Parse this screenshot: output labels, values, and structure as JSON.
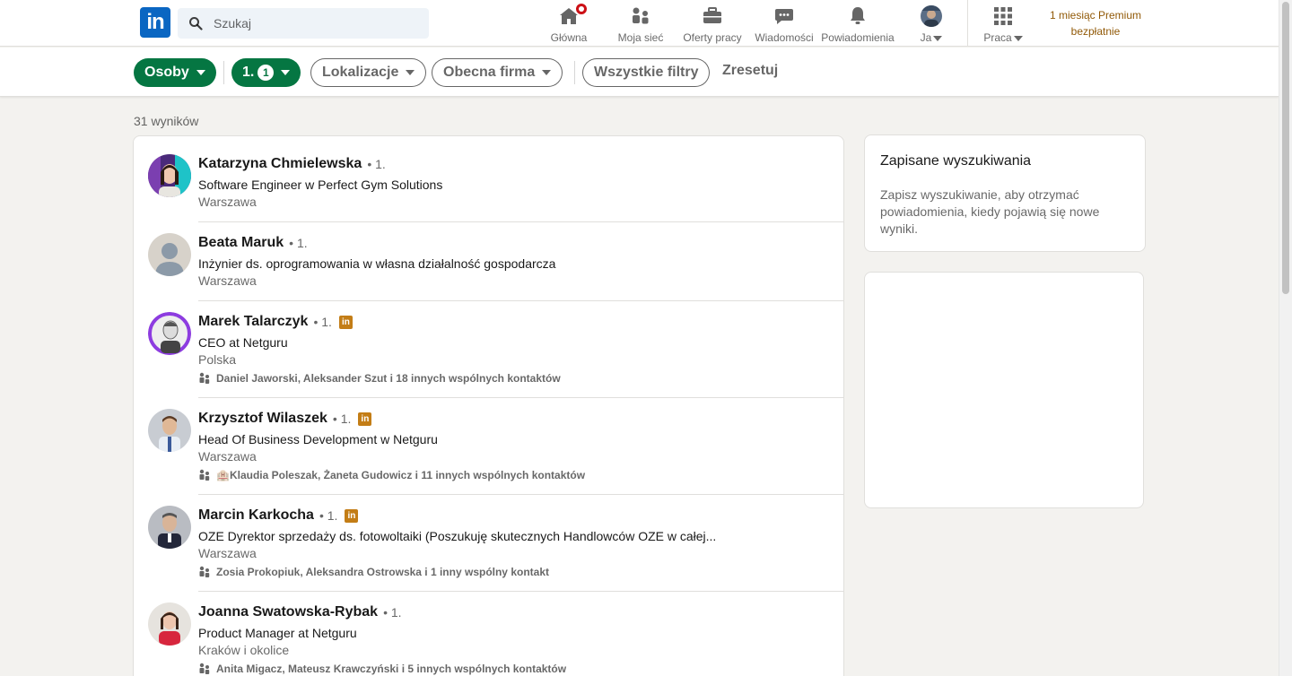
{
  "nav": {
    "logo": "in",
    "search_placeholder": "Szukaj",
    "items": [
      {
        "label": "Główna",
        "icon": "home-icon",
        "badge": true
      },
      {
        "label": "Moja sieć",
        "icon": "network-icon"
      },
      {
        "label": "Oferty pracy",
        "icon": "briefcase-icon"
      },
      {
        "label": "Wiadomości",
        "icon": "messaging-icon"
      },
      {
        "label": "Powiadomienia",
        "icon": "bell-icon"
      },
      {
        "label": "Ja",
        "icon": "avatar"
      },
      {
        "label": "Praca",
        "icon": "grid-icon"
      }
    ],
    "premium_line1": "1 miesiąc Premium",
    "premium_line2": "bezpłatnie",
    "premium_color": "#915907"
  },
  "filters": {
    "people": "Osoby",
    "degree": "1.",
    "degree_count": "1",
    "locations": "Lokalizacje",
    "current_company": "Obecna firma",
    "all_filters": "Wszystkie filtry",
    "reset": "Zresetuj",
    "accent": "#057642"
  },
  "results_count": "31 wyników",
  "results": [
    {
      "name": "Katarzyna Chmielewska",
      "degree": "• 1.",
      "title": "Software Engineer w Perfect Gym Solutions",
      "location": "Warszawa",
      "shared": "",
      "premium": false
    },
    {
      "name": "Beata Maruk",
      "degree": "• 1.",
      "title": "Inżynier ds. oprogramowania w własna działalność gospodarcza",
      "location": "Warszawa",
      "shared": "",
      "premium": false
    },
    {
      "name": "Marek Talarczyk",
      "degree": "• 1.",
      "title": "CEO at Netguru",
      "location": "Polska",
      "shared": "Daniel Jaworski, Aleksander Szut i 18 innych wspólnych kontaktów",
      "premium": true
    },
    {
      "name": "Krzysztof Wilaszek",
      "degree": "• 1.",
      "title": "Head Of Business Development w Netguru",
      "location": "Warszawa",
      "shared": "🏨Klaudia Poleszak, Żaneta Gudowicz i 11 innych wspólnych kontaktów",
      "premium": true
    },
    {
      "name": "Marcin Karkocha",
      "degree": "• 1.",
      "title": "OZE Dyrektor sprzedaży ds. fotowoltaiki (Poszukuję skutecznych Handlowców OZE w całej...",
      "location": "Warszawa",
      "shared": "Zosia Prokopiuk, Aleksandra Ostrowska i 1 inny wspólny kontakt",
      "premium": true
    },
    {
      "name": "Joanna Swatowska-Rybak",
      "degree": "• 1.",
      "title": "Product Manager at Netguru",
      "location": "Kraków i okolice",
      "shared": "Anita Migacz, Mateusz Krawczyński i 5 innych wspólnych kontaktów",
      "premium": false
    }
  ],
  "premium_badge": "in",
  "saved_searches": {
    "title": "Zapisane wyszukiwania",
    "description": "Zapisz wyszukiwanie, aby otrzymać powiadomienia, kiedy pojawią się nowe wyniki."
  }
}
